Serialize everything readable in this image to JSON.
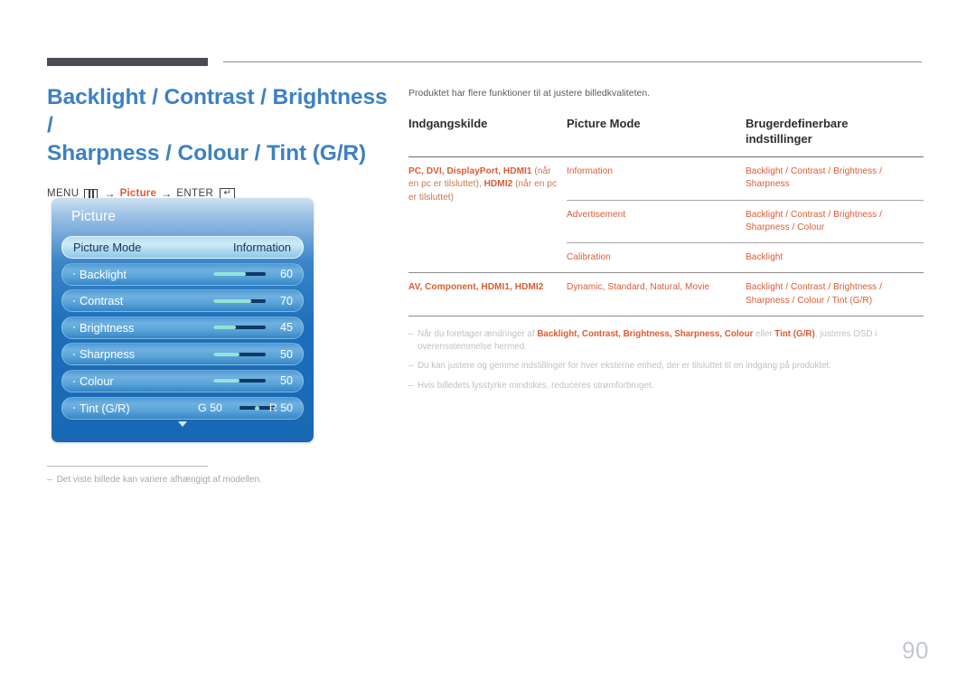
{
  "document": {
    "page_number": "90",
    "title_line1": "Backlight / Contrast / Brightness /",
    "title_line2": "Sharpness / Colour / Tint (G/R)",
    "title_color": "#3d81c2",
    "accent_orange": "#dd5a33"
  },
  "breadcrumb": {
    "menu_label": "MENU",
    "menu_icon": "menu-bars-icon",
    "arrow1": "→",
    "section": "Picture",
    "arrow2": "→",
    "enter_label": "ENTER",
    "enter_icon": "enter-key-icon",
    "enter_glyph": "↵"
  },
  "osd": {
    "title": "Picture",
    "caret_icon": "chevron-down-icon",
    "rows": [
      {
        "label": "Picture Mode",
        "value": "Information",
        "selected": true,
        "type": "value"
      },
      {
        "label": "Backlight",
        "value": "60",
        "type": "slider",
        "fill_percent": 62
      },
      {
        "label": "Contrast",
        "value": "70",
        "type": "slider",
        "fill_percent": 72
      },
      {
        "label": "Brightness",
        "value": "45",
        "type": "slider",
        "fill_percent": 43
      },
      {
        "label": "Sharpness",
        "value": "50",
        "type": "slider",
        "fill_percent": 50
      },
      {
        "label": "Colour",
        "value": "50",
        "type": "slider",
        "fill_percent": 50
      },
      {
        "label": "Tint (G/R)",
        "type": "tint",
        "left_value": "G 50",
        "right_value": "R 50"
      }
    ]
  },
  "left_note": {
    "dash": "–",
    "text": "Det viste billede kan variere afhængigt af modellen."
  },
  "right": {
    "intro": "Produktet har flere funktioner til at justere billedkvaliteten.",
    "table": {
      "headers": [
        "Indgangskilde",
        "Picture Mode",
        "Brugerdefinerbare indstillinger"
      ],
      "header3_line1": "Brugerdefinerbare",
      "header3_line2": "indstillinger",
      "groups": [
        {
          "source_bold_1": "PC",
          "source_sep_1": ", ",
          "source_bold_2": "DVI",
          "source_bold_3": "DisplayPort",
          "source_bold_4": "HDMI1",
          "source_plain_1": " (når en pc er tilsluttet), ",
          "source_bold_5": "HDMI2",
          "source_plain_2": " (når en pc er tilsluttet)",
          "source_full": "PC, DVI, DisplayPort, HDMI1 (når en pc er tilsluttet), HDMI2 (når en pc er tilsluttet)",
          "rows": [
            {
              "mode": "Information",
              "settings": "Backlight / Contrast / Brightness / Sharpness"
            },
            {
              "mode": "Advertisement",
              "settings": "Backlight / Contrast / Brightness / Sharpness / Colour"
            },
            {
              "mode": "Calibration",
              "settings": "Backlight"
            }
          ]
        },
        {
          "source_full": "AV, Component, HDMI1, HDMI2",
          "rows": [
            {
              "mode": "Dynamic, Standard, Natural, Movie",
              "settings": "Backlight / Contrast / Brightness / Sharpness / Colour / Tint (G/R)"
            }
          ]
        }
      ]
    },
    "footnotes": [
      {
        "dash": "–",
        "prefix": "Når du foretager ændringer af ",
        "highlights": "Backlight, Contrast, Brightness, Sharpness, Colour",
        "middle": " eller ",
        "highlight2": "Tint (G/R)",
        "suffix": ", justeres OSD i overensstemmelse hermed."
      },
      {
        "dash": "–",
        "text": "Du kan justere og gemme indstillinger for hver eksterne enhed, der er tilsluttet til en indgang på produktet."
      },
      {
        "dash": "–",
        "text": "Hvis billedets lysstyrke mindskes, reduceres strømforbruget."
      }
    ]
  }
}
